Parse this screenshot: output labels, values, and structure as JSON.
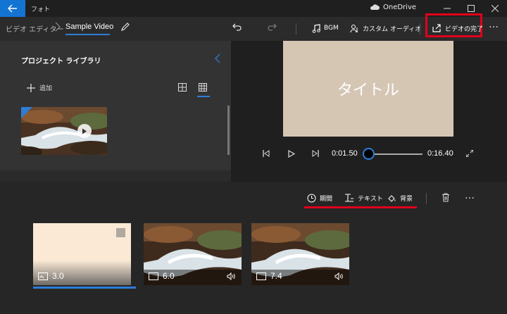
{
  "app": {
    "title": "フォト",
    "onedrive_label": "OneDrive"
  },
  "breadcrumb": {
    "parent": "ビデオ エディター",
    "current": "Sample Video"
  },
  "toolbar": {
    "bgm_label": "BGM",
    "custom_audio_label": "カスタム オーディオ",
    "finish_video_label": "ビデオの完了",
    "more_label": "…"
  },
  "library": {
    "title": "プロジェクト ライブラリ",
    "add_label": "追加"
  },
  "preview": {
    "title_text": "タイトル"
  },
  "player": {
    "current_time": "0:01.50",
    "total_time": "0:16.40",
    "progress": 0.092
  },
  "storyboard": {
    "duration_label": "期間",
    "text_label": "テキスト",
    "background_label": "背景",
    "more_label": "…",
    "clips": [
      {
        "type": "title-card",
        "duration": "3.0",
        "selected": true
      },
      {
        "type": "video",
        "duration": "6.0",
        "selected": false
      },
      {
        "type": "video",
        "duration": "7.4",
        "selected": false
      }
    ]
  },
  "colors": {
    "accent": "#2e7dd6",
    "highlight": "#e0001b",
    "title_card": "#fbe9d6",
    "preview_bg": "#d5c6b4"
  }
}
